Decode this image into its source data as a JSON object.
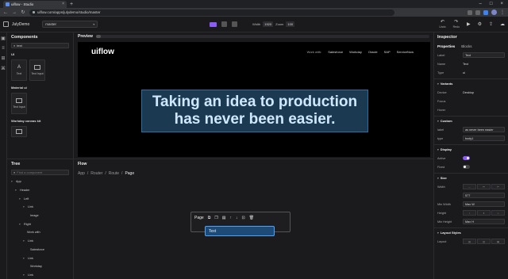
{
  "browser": {
    "tab_title": "uiflow - Studio",
    "url": "uiflow.com/apps/julydemo/studio/master",
    "new_tab": "+"
  },
  "app": {
    "project": "JulyDemo",
    "branch": "master",
    "width_label": "Width",
    "width_value": "1920",
    "zoom_label": "Zoom",
    "zoom_value": "100",
    "tools": [
      {
        "icon": "undo-icon",
        "label": "Undo"
      },
      {
        "icon": "redo-icon",
        "label": "Redo"
      }
    ]
  },
  "components": {
    "title": "Components",
    "search_value": "text",
    "sections": [
      {
        "name": "UI",
        "items": [
          "Text",
          "Text Input"
        ]
      },
      {
        "name": "Material ui",
        "items": [
          "Text Input"
        ]
      },
      {
        "name": "Workday canvas kit",
        "items": [
          ""
        ]
      }
    ]
  },
  "tree": {
    "title": "Tree",
    "search_placeholder": "Find a component",
    "items": [
      {
        "label": "App",
        "depth": 0
      },
      {
        "label": "Header",
        "depth": 1
      },
      {
        "label": "Left",
        "depth": 2
      },
      {
        "label": "Link",
        "depth": 3
      },
      {
        "label": "Image",
        "depth": 4
      },
      {
        "label": "Right",
        "depth": 2
      },
      {
        "label": "Work with",
        "depth": 3
      },
      {
        "label": "Link",
        "depth": 3
      },
      {
        "label": "Salesforce",
        "depth": 4
      },
      {
        "label": "Link",
        "depth": 3
      },
      {
        "label": "Workday",
        "depth": 4
      },
      {
        "label": "Link",
        "depth": 3
      }
    ]
  },
  "preview": {
    "title": "Preview",
    "brand": "uiflow",
    "nav": [
      "Work with:",
      "Salesforce",
      "Workday",
      "Oracle",
      "SAP",
      "ServiceNow"
    ],
    "hero_line1": "Taking an idea to production",
    "hero_line2": "has never been easier."
  },
  "flow": {
    "title": "Flow",
    "breadcrumb": [
      "App",
      "Router",
      "Route",
      "Page"
    ],
    "page_label": "Page",
    "node_label": "Text"
  },
  "inspector": {
    "title": "Inspector",
    "tabs": [
      "Properties",
      "Blocks"
    ],
    "label_field": {
      "label": "Label",
      "value": "Text"
    },
    "name_field": {
      "label": "Name",
      "value": "Text"
    },
    "type_field": {
      "label": "Type",
      "value": "ui"
    },
    "variants_title": "Variants",
    "variants": [
      {
        "label": "Device",
        "value": "Desktop"
      },
      {
        "label": "Focus",
        "value": ""
      },
      {
        "label": "Hover",
        "value": ""
      }
    ],
    "custom_title": "Custom",
    "custom": [
      {
        "label": "label",
        "value": "as never been easier"
      },
      {
        "label": "type",
        "value": "body1"
      }
    ],
    "display_title": "Display",
    "display": [
      {
        "label": "Active",
        "on": true
      },
      {
        "label": "Fixed",
        "on": false
      }
    ],
    "size_title": "Size",
    "size": [
      {
        "label": "Width",
        "value": ""
      },
      {
        "label": "",
        "value": "577"
      },
      {
        "label": "Min Width",
        "value": "Max W"
      },
      {
        "label": "Height",
        "value": ""
      },
      {
        "label": "Min Height",
        "value": "Max H"
      }
    ],
    "layout_title": "Layout Styles",
    "layout": [
      {
        "label": "Layout",
        "value": ""
      }
    ]
  },
  "colors": {
    "accent": "#8b5cf6",
    "selection": "#4ea3ff",
    "hero_bg": "#1b3a52"
  }
}
